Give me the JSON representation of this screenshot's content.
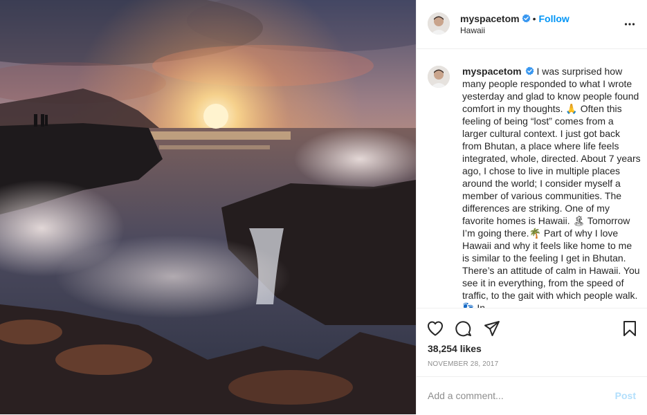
{
  "post": {
    "username": "myspacetom",
    "location": "Hawaii",
    "follow_label": "Follow",
    "separator": "•",
    "caption": "I was surprised how many people responded to what I wrote yesterday and glad to know people found comfort in my thoughts. 🙏 Often this feeling of being “lost” comes from a larger cultural context. I just got back from Bhutan, a place where life feels integrated, whole, directed. About 7 years ago, I chose to live in multiple places around the world; I consider myself a member of various communities. The differences are striking. One of my favorite homes is Hawaii. 🏝 Tomorrow I’m going there.🌴 Part of why I love Hawaii and why it feels like home to me is similar to the feeling I get in Bhutan. There’s an attitude of calm in Hawaii. You see it in everything, from the speed of traffic, to the gait with which people walk. 👣 In",
    "likes": "38,254 likes",
    "date": "NOVEMBER 28, 2017",
    "comment_placeholder": "Add a comment...",
    "post_label": "Post"
  },
  "colors": {
    "link_blue": "#0095f6",
    "post_disabled": "#b2dffc",
    "verified_blue": "#3897f0",
    "muted_text": "#8e8e8e",
    "divider": "#efefef"
  },
  "icons": {
    "verified": "verified-badge-icon",
    "more": "more-options-icon",
    "like": "heart-icon",
    "comment": "comment-bubble-icon",
    "share": "paper-plane-icon",
    "save": "bookmark-icon"
  }
}
